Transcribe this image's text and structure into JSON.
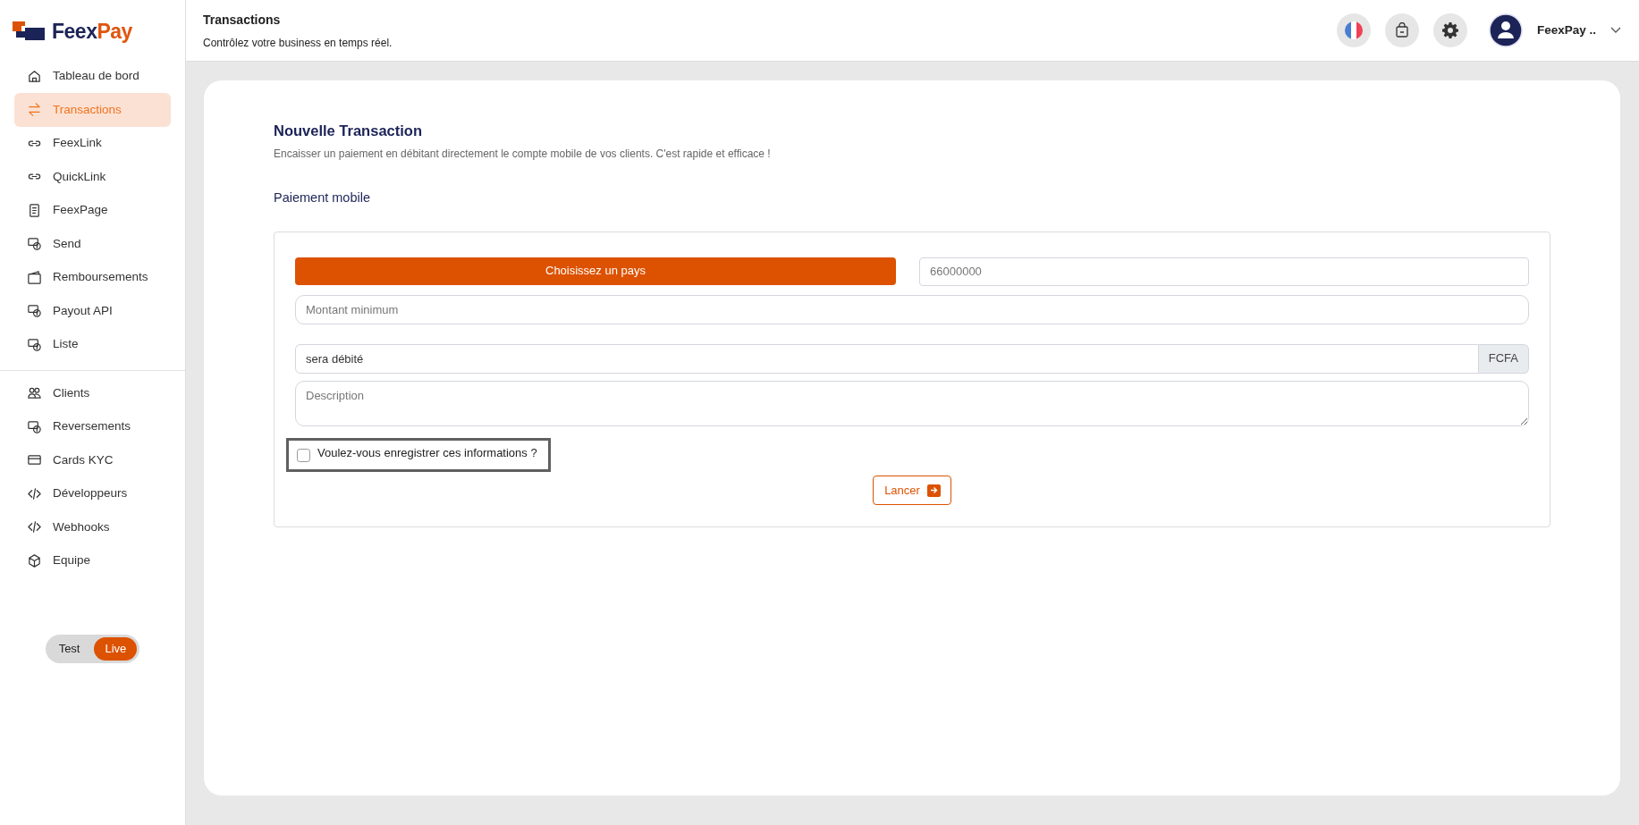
{
  "brand": {
    "name_part1": "Feex",
    "name_part2": "Pay"
  },
  "sidebar": {
    "groups": [
      {
        "items": [
          {
            "label": "Tableau de bord",
            "selected": false
          },
          {
            "label": "Transactions",
            "selected": true
          },
          {
            "label": "FeexLink",
            "selected": false
          },
          {
            "label": "QuickLink",
            "selected": false
          },
          {
            "label": "FeexPage",
            "selected": false
          },
          {
            "label": "Send",
            "selected": false
          },
          {
            "label": "Remboursements",
            "selected": false
          },
          {
            "label": "Payout API",
            "selected": false
          },
          {
            "label": "Liste",
            "selected": false
          }
        ]
      },
      {
        "items": [
          {
            "label": "Clients",
            "selected": false
          },
          {
            "label": "Reversements",
            "selected": false
          },
          {
            "label": "Cards KYC",
            "selected": false
          },
          {
            "label": "Développeurs",
            "selected": false
          },
          {
            "label": "Webhooks",
            "selected": false
          },
          {
            "label": "Equipe",
            "selected": false
          }
        ]
      }
    ]
  },
  "mode_toggle": {
    "options": [
      {
        "label": "Test",
        "selected": false
      },
      {
        "label": "Live",
        "selected": true
      }
    ]
  },
  "header": {
    "title": "Transactions",
    "subtitle": "Contrôlez votre business en temps réel.",
    "user_name": "FeexPay .."
  },
  "page": {
    "title": "Nouvelle Transaction",
    "description": "Encaisser un paiement en débitant directement le compte mobile de vos clients. C'est rapide et efficace !",
    "section_title": "Paiement mobile"
  },
  "form": {
    "country_button": "Choisissez un pays",
    "phone": {
      "placeholder": "66000000"
    },
    "amount": {
      "placeholder": "Montant minimum"
    },
    "debited": {
      "value": "sera débité",
      "currency": "FCFA"
    },
    "description": {
      "placeholder": "Description"
    },
    "save_option": {
      "label": "Voulez-vous enregistrer ces informations ?",
      "checked": false,
      "highlighted": true
    },
    "submit": "Lancer"
  }
}
